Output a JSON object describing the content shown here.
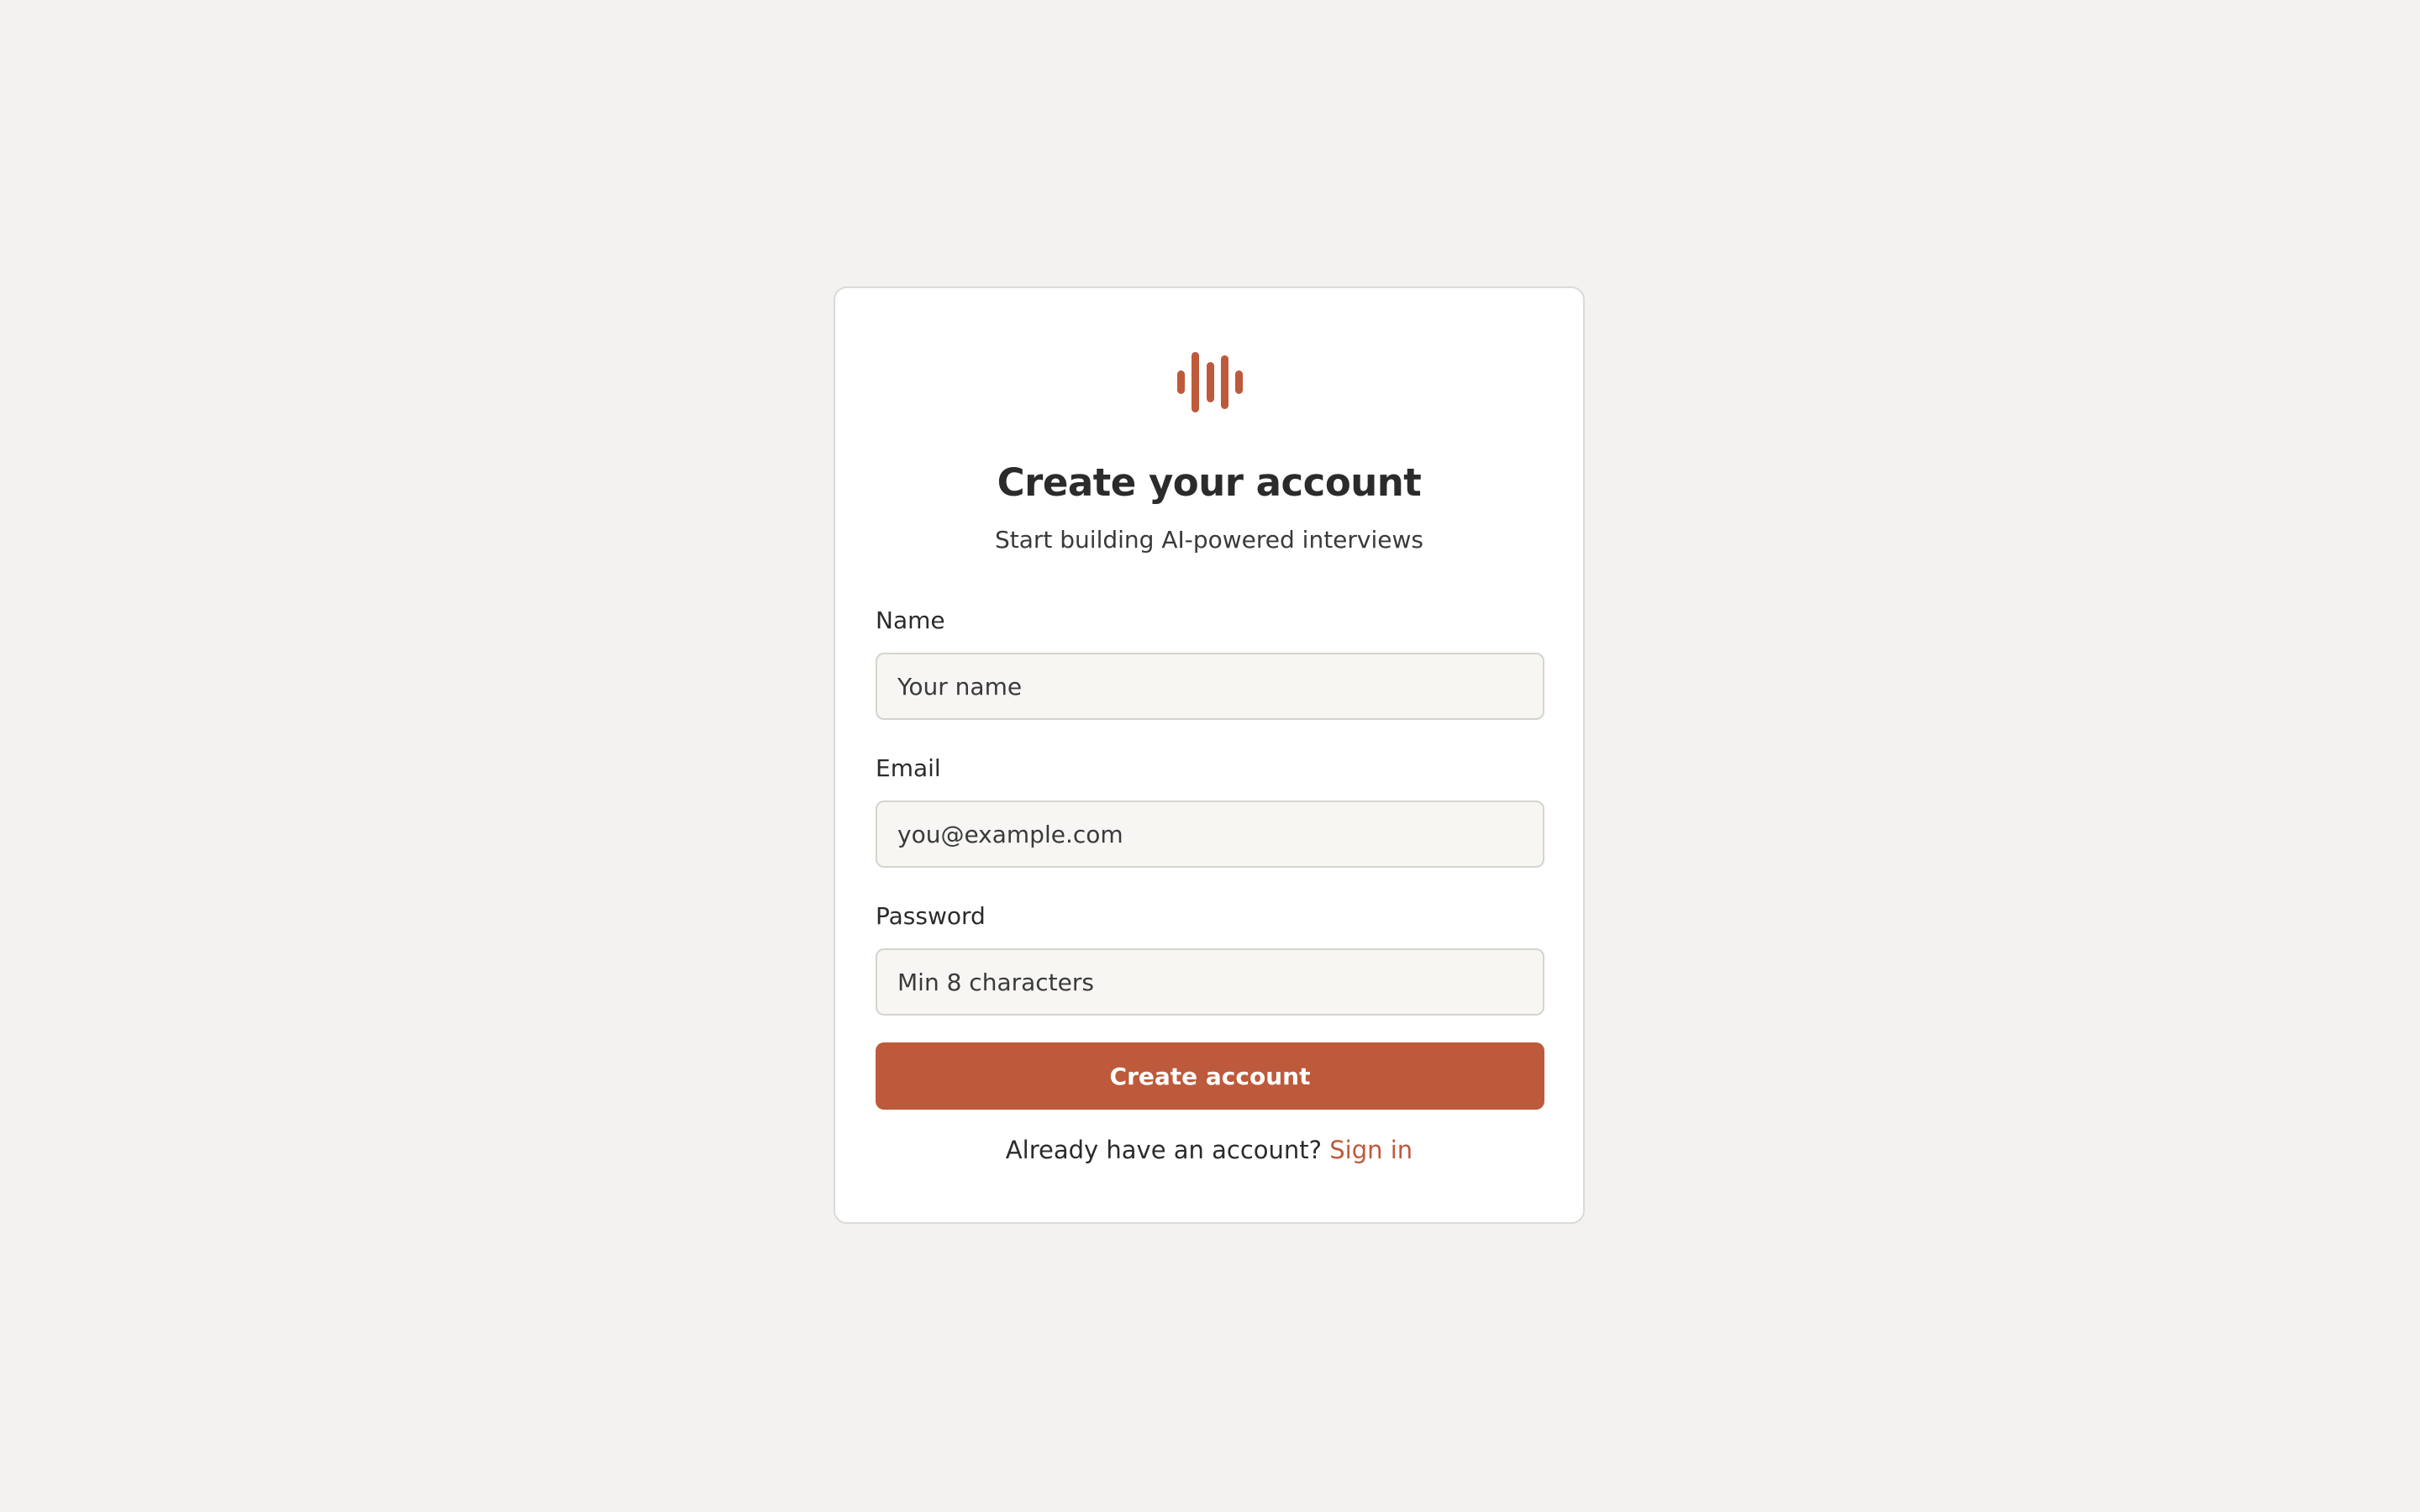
{
  "brand": {
    "logo_icon": "audio-waveform-icon",
    "accent_color": "#bd5a3b"
  },
  "signup": {
    "heading": "Create your account",
    "subtitle": "Start building AI-powered interviews",
    "fields": {
      "name": {
        "label": "Name",
        "placeholder": "Your name",
        "value": ""
      },
      "email": {
        "label": "Email",
        "placeholder": "you@example.com",
        "value": ""
      },
      "password": {
        "label": "Password",
        "placeholder": "Min 8 characters",
        "value": ""
      }
    },
    "submit_label": "Create account",
    "footer_prompt": "Already have an account?",
    "signin_link": "Sign in"
  }
}
